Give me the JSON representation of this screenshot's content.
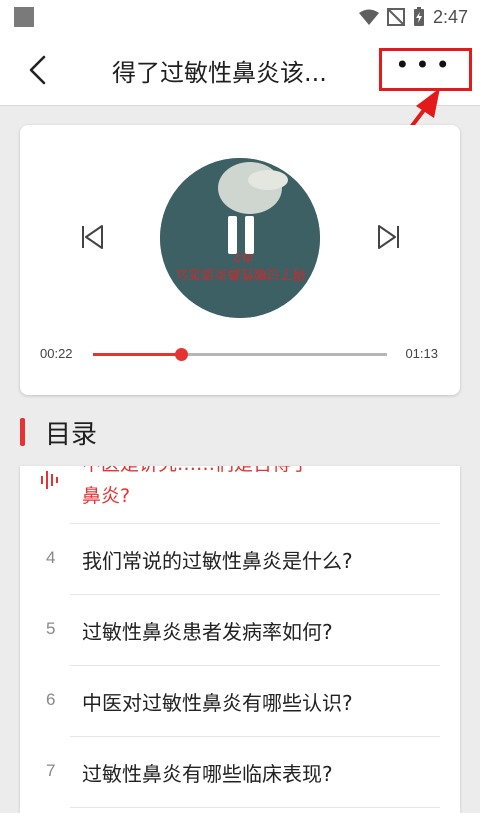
{
  "status_bar": {
    "time": "2:47",
    "icons": [
      "square-icon",
      "wifi-icon",
      "no-signal-icon",
      "battery-charging-icon"
    ]
  },
  "header": {
    "title": "得了过敏性鼻炎该...",
    "back_icon": "chevron-left-icon",
    "more_icon": "more-horizontal-icon",
    "highlight_color": "#e21a1a"
  },
  "player": {
    "cover_text": "得了过敏性鼻炎该怎么办？",
    "current_time": "00:22",
    "total_time": "01:13",
    "progress_fraction": 0.3,
    "accent_color": "#e53333",
    "icons": [
      "skip-previous-icon",
      "pause-icon",
      "skip-next-icon"
    ]
  },
  "toc": {
    "title": "目录",
    "active_item": {
      "text_line1": "中医是讲究……们是否得了",
      "text_line2": "鼻炎?",
      "icon": "audio-wave-icon"
    },
    "items": [
      {
        "num": "4",
        "text": "我们常说的过敏性鼻炎是什么?"
      },
      {
        "num": "5",
        "text": "过敏性鼻炎患者发病率如何?"
      },
      {
        "num": "6",
        "text": "中医对过敏性鼻炎有哪些认识?"
      },
      {
        "num": "7",
        "text": "过敏性鼻炎有哪些临床表现?"
      }
    ]
  }
}
